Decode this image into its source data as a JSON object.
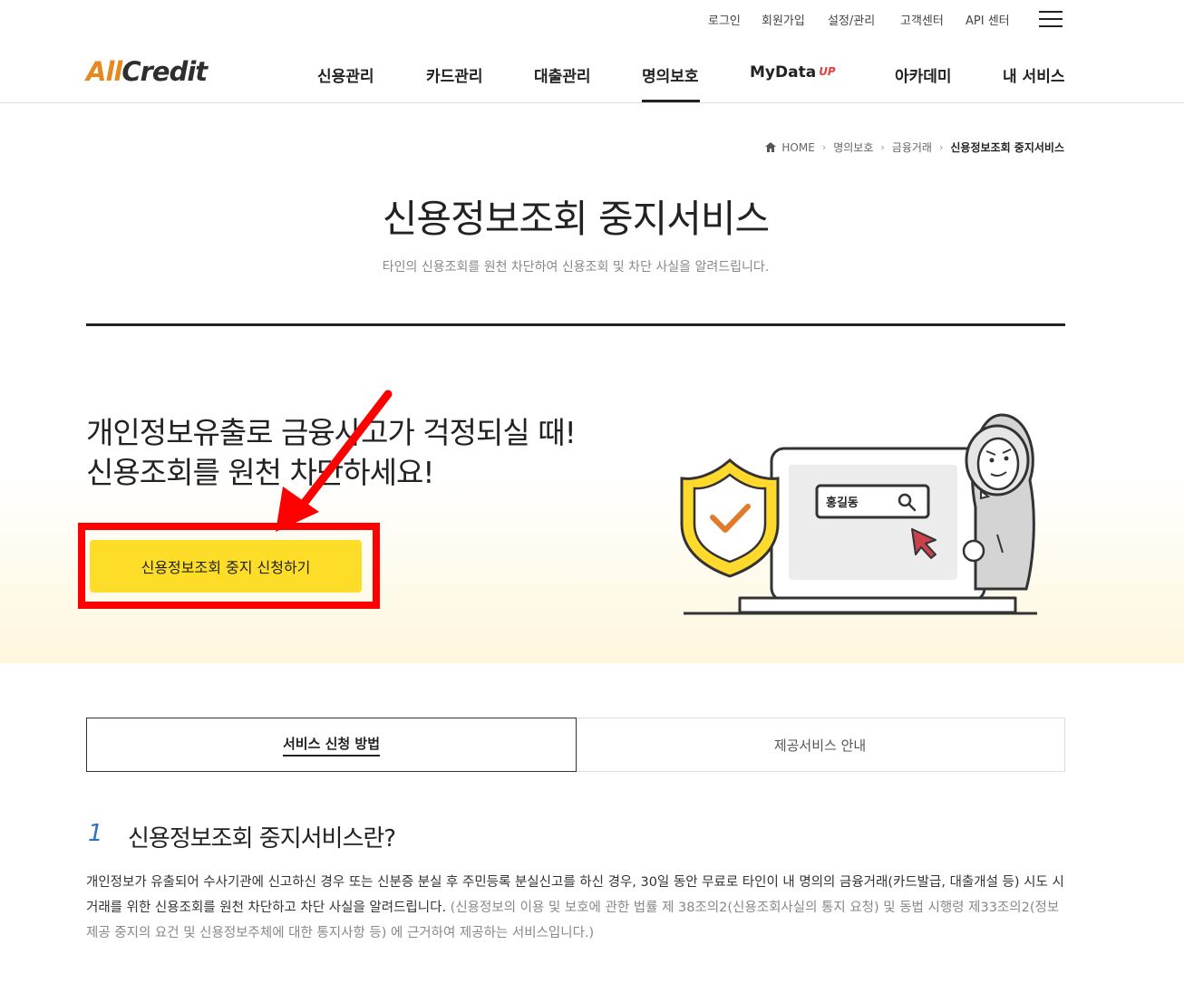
{
  "util_nav": [
    "로그인",
    "회원가입",
    "설정/관리",
    "고객센터",
    "API 센터"
  ],
  "logo": {
    "part1": "All",
    "part2": "Credit"
  },
  "gnb": {
    "items": [
      "신용관리",
      "카드관리",
      "대출관리",
      "명의보호",
      "MyData",
      "아카데미",
      "내 서비스"
    ],
    "mydata_badge": "UP",
    "active": "명의보호"
  },
  "breadcrumb": {
    "home": "HOME",
    "items": [
      "명의보호",
      "금융거래",
      "신용정보조회 중지서비스"
    ]
  },
  "page": {
    "title": "신용정보조회 중지서비스",
    "subtitle": "타인의 신용조회를 원천 차단하여 신용조회 및 차단 사실을 알려드립니다."
  },
  "hero": {
    "line1": "개인정보유출로 금융사고가 걱정되실 때!",
    "line2": "신용조회를 원천 차단하세요!",
    "button": "신용정보조회 중지 신청하기",
    "search_name": "홍길동"
  },
  "tabs": [
    {
      "label": "서비스 신청 방법",
      "active": true
    },
    {
      "label": "제공서비스 안내",
      "active": false
    }
  ],
  "section": {
    "number": "1",
    "title": "신용정보조회 중지서비스란?",
    "body_main": "개인정보가 유출되어 수사기관에 신고하신 경우 또는 신분증 분실 후 주민등록 분실신고를 하신 경우, 30일 동안 무료로 타인이 내 명의의 금융거래(카드발급, 대출개설 등) 시도 시 거래를 위한 신용조회를 원천 차단하고 차단 사실을 알려드립니다.",
    "body_note": "(신용정보의 이용 및 보호에 관한 법률 제 38조의2(신용조회사실의 통지 요청) 및 동법 시행령 제33조의2(정보제공 중지의 요건 및 신용정보주체에 대한 통지사항 등) 에 근거하여 제공하는 서비스입니다.)"
  },
  "colors": {
    "accent_yellow": "#fddd28",
    "logo_orange": "#e48a1f",
    "section_number_blue": "#2f6fc4",
    "highlight_red": "#ff0000"
  }
}
